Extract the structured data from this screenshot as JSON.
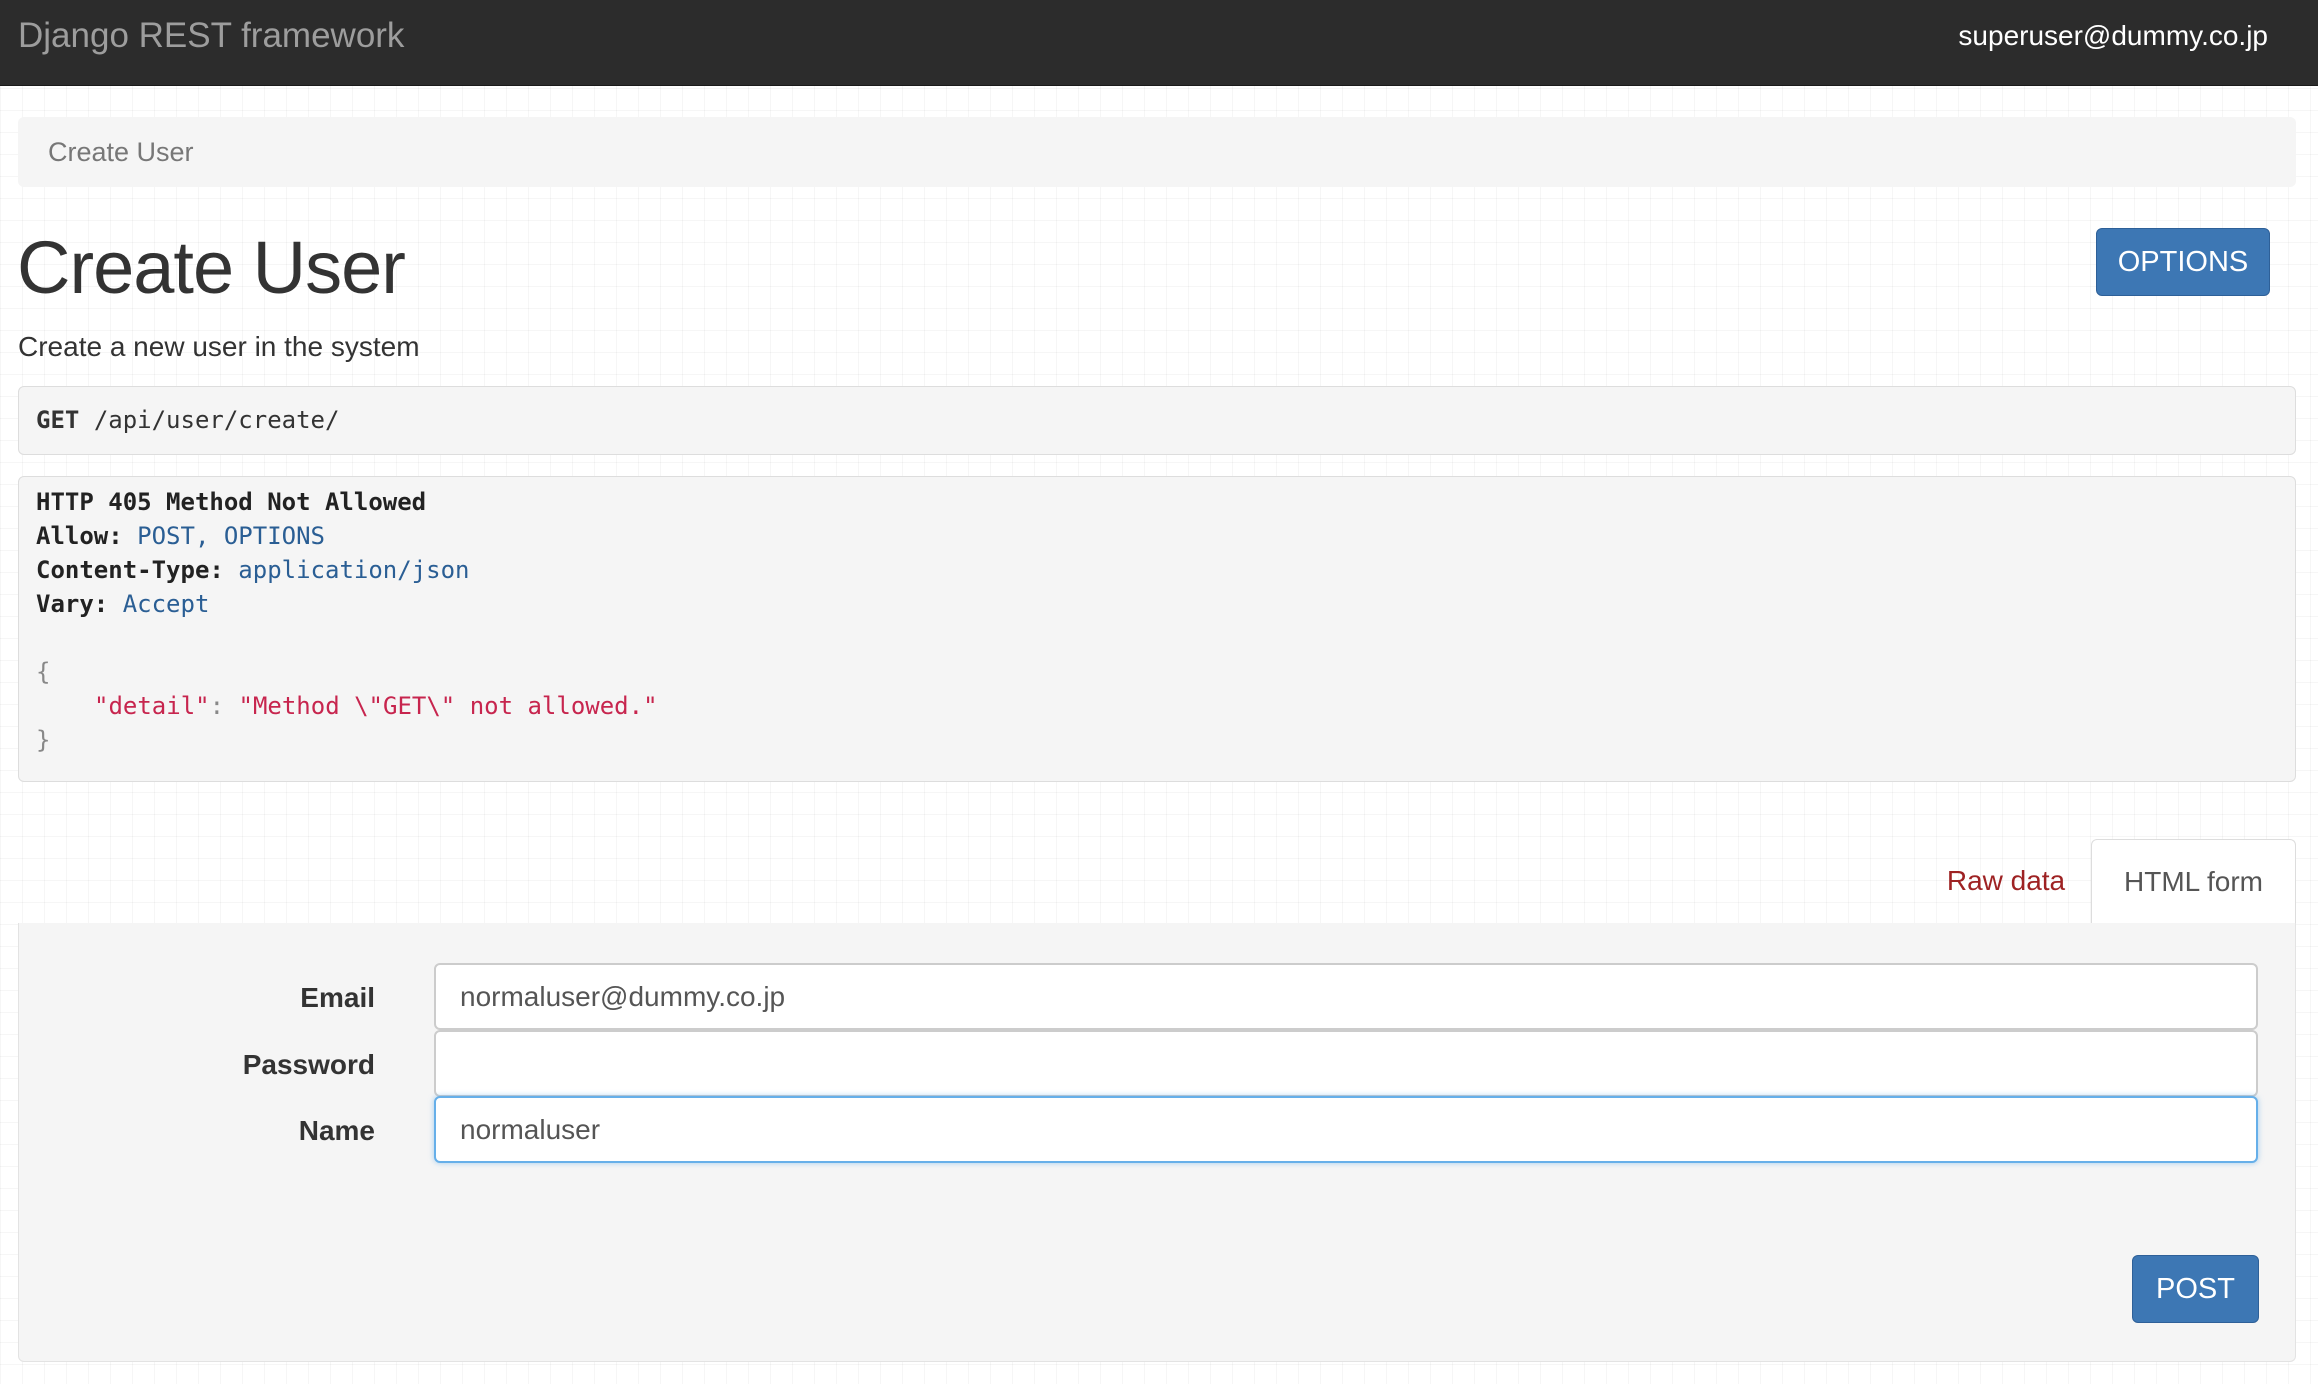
{
  "navbar": {
    "brand": "Django REST framework",
    "user": "superuser@dummy.co.jp"
  },
  "breadcrumb": {
    "items": [
      "Create User"
    ]
  },
  "page": {
    "title": "Create User",
    "description": "Create a new user in the system",
    "options_label": "OPTIONS"
  },
  "request": {
    "method": "GET",
    "path": "/api/user/create/"
  },
  "response": {
    "status_line": "HTTP 405 Method Not Allowed",
    "headers": [
      {
        "name": "Allow:",
        "value": "POST, OPTIONS"
      },
      {
        "name": "Content-Type:",
        "value": "application/json"
      },
      {
        "name": "Vary:",
        "value": "Accept"
      }
    ],
    "body": {
      "open": "{",
      "key": "\"detail\"",
      "colon": ": ",
      "value": "\"Method \\\"GET\\\" not allowed.\"",
      "close": "}"
    }
  },
  "tabs": [
    {
      "label": "Raw data",
      "active": false
    },
    {
      "label": "HTML form",
      "active": true
    }
  ],
  "form": {
    "fields": [
      {
        "label": "Email",
        "value": "normaluser@dummy.co.jp",
        "placeholder": ""
      },
      {
        "label": "Password",
        "value": "",
        "placeholder": ""
      },
      {
        "label": "Name",
        "value": "normaluser",
        "placeholder": ""
      }
    ],
    "submit_label": "POST"
  },
  "colors": {
    "navbar_bg": "#2c2c2c",
    "primary_button": "#3d77b4",
    "link_red": "#9e2223",
    "header_value_blue": "#2a5e94",
    "json_string": "#c7254e"
  }
}
